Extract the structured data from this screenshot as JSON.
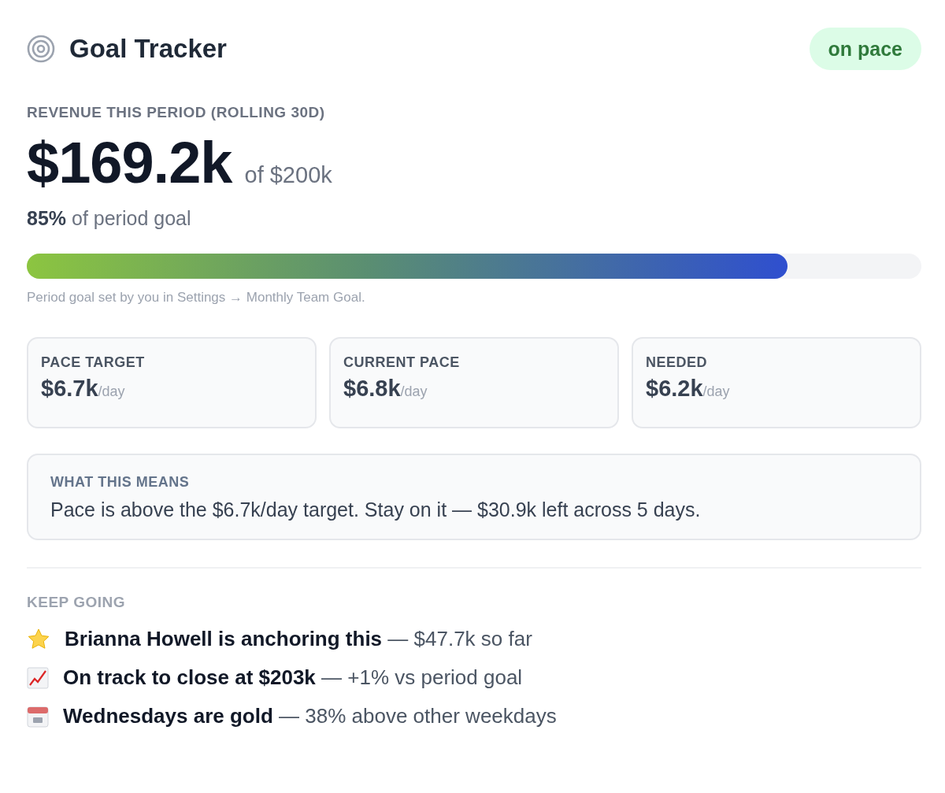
{
  "header": {
    "title": "Goal Tracker",
    "status": {
      "label": "on pace",
      "positive": true
    }
  },
  "revenue": {
    "label": "REVENUE THIS PERIOD (ROLLING 30D)",
    "amount": "$169.2k",
    "of_goal": "of $200k",
    "percent": "85%",
    "percent_text": "of period goal",
    "level": 0.85,
    "note": "Period goal set by you in Settings → Monthly Team Goal."
  },
  "stats": [
    {
      "label": "PACE TARGET",
      "value": "$6.7k",
      "unit": "/day"
    },
    {
      "label": "CURRENT PACE",
      "value": "$6.8k",
      "unit": "/day"
    },
    {
      "label": "NEEDED",
      "value": "$6.2k",
      "unit": "/day"
    }
  ],
  "explanation": {
    "title": "WHAT THIS MEANS",
    "text": "Pace is above the $6.7k/day target. Stay on it — $30.9k left across 5 days."
  },
  "insights": {
    "title": "KEEP GOING",
    "items": [
      {
        "kind": "star",
        "text": "**Brianna Howell is anchoring this** — $47.7k so far"
      },
      {
        "kind": "chart",
        "text": "**On track to close at $203k** — +1% vs period goal"
      },
      {
        "kind": "calendar",
        "text": "**Wednesdays are gold** — 38% above other weekdays"
      }
    ]
  }
}
